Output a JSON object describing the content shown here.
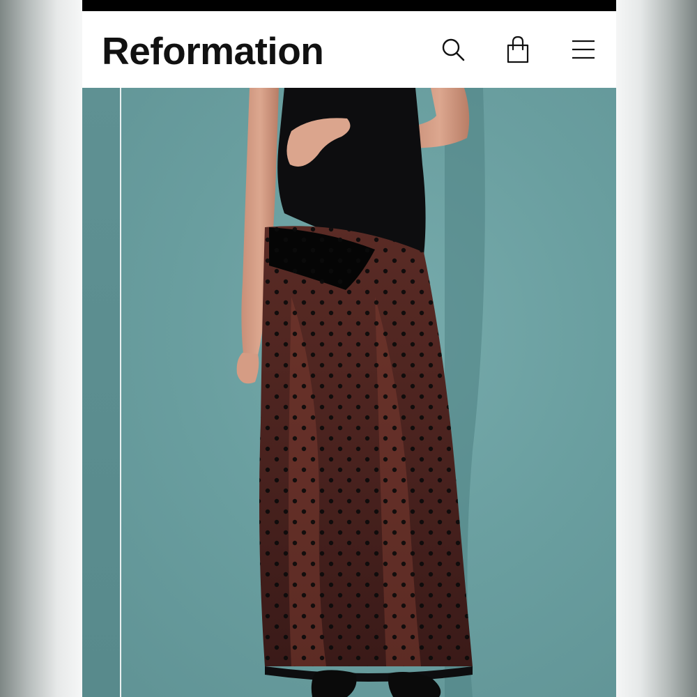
{
  "header": {
    "logo": "Reformation",
    "icons": {
      "search": "search-icon",
      "bag": "shopping-bag-icon",
      "menu": "hamburger-menu-icon"
    }
  },
  "hero": {
    "image": "product-photo-sheer-polka-dot-maxi-skirt",
    "background_color": "#6a9ea0"
  },
  "colors": {
    "header_bg": "#ffffff",
    "status_bar": "#000000",
    "logo_text": "#111111"
  }
}
